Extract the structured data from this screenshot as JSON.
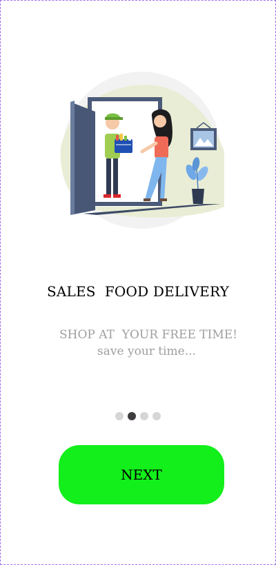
{
  "onboarding": {
    "title": "SALES  FOOD DELIVERY",
    "subtitle": "SHOP AT  YOUR FREE TIME!",
    "subtitle_sub": "save your time...",
    "page_indicator": {
      "total": 4,
      "active_index": 1
    },
    "next_label": "NEXT"
  },
  "colors": {
    "accent": "#12ef1a",
    "title_text": "#000000",
    "subtitle_text": "#a09d9d",
    "dot_inactive": "#d6d6d6",
    "dot_active": "#3f3c40"
  },
  "illustration": "delivery-person-handing-grocery-basket-at-door"
}
